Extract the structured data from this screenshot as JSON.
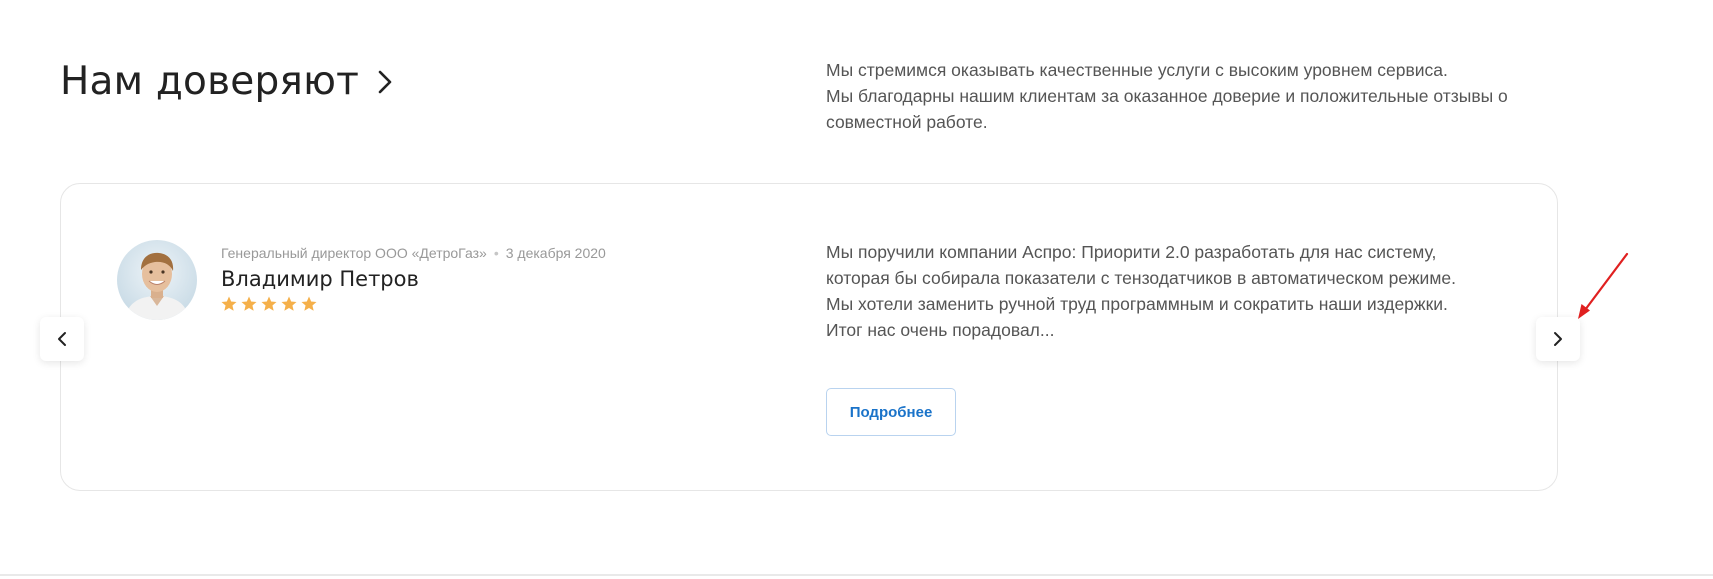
{
  "section": {
    "title": "Нам доверяют",
    "intro_lines": [
      "Мы стремимся оказывать качественные услуги с высоким уровнем сервиса.",
      "Мы благодарны нашим клиентам за оказанное доверие и положительные отзывы о совместной работе."
    ]
  },
  "review": {
    "position": "Генеральный директор ООО «ДетроГаз»",
    "separator": "•",
    "date": "3 декабря 2020",
    "author": "Владимир Петров",
    "rating": 5,
    "rating_max": 5,
    "text_lines": [
      "Мы поручили компании Аспро: Приорити 2.0 разработать для нас систему,",
      "которая бы собирала показатели с тензодатчиков в автоматическом режиме.",
      "Мы хотели заменить ручной труд программным и сократить наши издержки.",
      "Итог нас очень порадовал..."
    ],
    "more_label": "Подробнее"
  },
  "slider": {
    "prev_icon": "chevron-left-icon",
    "next_icon": "chevron-right-icon"
  },
  "colors": {
    "star": "#F5B04A",
    "accent": "#1A73C9",
    "annotation_arrow": "#E02020"
  }
}
